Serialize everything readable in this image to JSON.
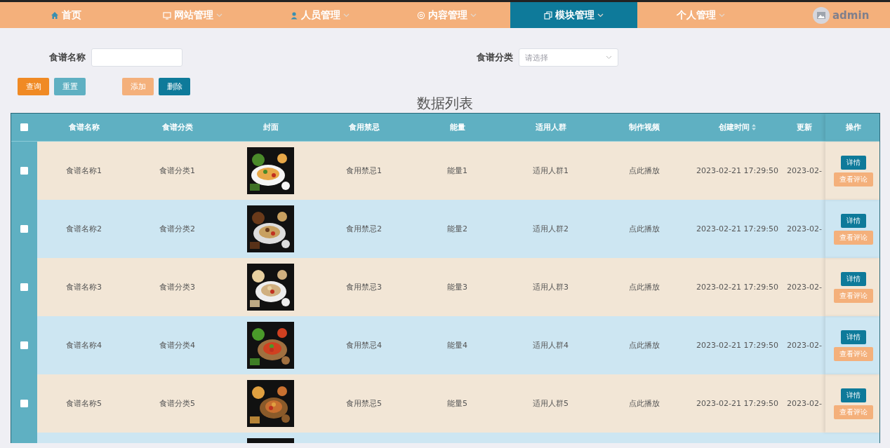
{
  "nav": {
    "items": [
      {
        "label": "首页",
        "dropdown": false,
        "selected": false
      },
      {
        "label": "网站管理",
        "dropdown": true,
        "selected": false
      },
      {
        "label": "人员管理",
        "dropdown": true,
        "selected": false
      },
      {
        "label": "内容管理",
        "dropdown": true,
        "selected": false
      },
      {
        "label": "模块管理",
        "dropdown": true,
        "selected": true
      },
      {
        "label": "个人管理",
        "dropdown": true,
        "selected": false
      }
    ],
    "user": "admin"
  },
  "filters": [
    {
      "label": "食谱名称",
      "kind": "text"
    },
    {
      "label": "食谱分类",
      "kind": "select",
      "placeholder": "请选择"
    }
  ],
  "buttons": [
    {
      "label": "查询",
      "kind": "query"
    },
    {
      "label": "重置",
      "kind": "reset"
    },
    {
      "label": "添加",
      "kind": "add"
    },
    {
      "label": "删除",
      "kind": "delete"
    }
  ],
  "list_title": "数据列表",
  "table": {
    "select_all": {
      "checked": false
    },
    "columns": [
      {
        "label": "食谱名称",
        "sortable": false
      },
      {
        "label": "食谱分类",
        "sortable": false
      },
      {
        "label": "封面",
        "sortable": false
      },
      {
        "label": "食用禁忌",
        "sortable": false
      },
      {
        "label": "能量",
        "sortable": false
      },
      {
        "label": "适用人群",
        "sortable": false
      },
      {
        "label": "制作视频",
        "sortable": false
      },
      {
        "label": "创建时间",
        "sortable": true
      },
      {
        "label": "更新",
        "sortable": false
      },
      {
        "label": "操作",
        "sortable": false
      }
    ],
    "rows": [
      {
        "checked": false,
        "name": "食谱名称1",
        "category": "食谱分类1",
        "taboo": "食用禁忌1",
        "energy": "能量1",
        "crowd": "适用人群1",
        "video": "点此播放",
        "created": "2023-02-21 17:29:50",
        "updated": "2023-02-",
        "actions": [
          "详情",
          "查看评论"
        ]
      },
      {
        "checked": false,
        "name": "食谱名称2",
        "category": "食谱分类2",
        "taboo": "食用禁忌2",
        "energy": "能量2",
        "crowd": "适用人群2",
        "video": "点此播放",
        "created": "2023-02-21 17:29:50",
        "updated": "2023-02-",
        "actions": [
          "详情",
          "查看评论"
        ]
      },
      {
        "checked": false,
        "name": "食谱名称3",
        "category": "食谱分类3",
        "taboo": "食用禁忌3",
        "energy": "能量3",
        "crowd": "适用人群3",
        "video": "点此播放",
        "created": "2023-02-21 17:29:50",
        "updated": "2023-02-",
        "actions": [
          "详情",
          "查看评论"
        ]
      },
      {
        "checked": false,
        "name": "食谱名称4",
        "category": "食谱分类4",
        "taboo": "食用禁忌4",
        "energy": "能量4",
        "crowd": "适用人群4",
        "video": "点此播放",
        "created": "2023-02-21 17:29:50",
        "updated": "2023-02-",
        "actions": [
          "详情",
          "查看评论"
        ]
      },
      {
        "checked": false,
        "name": "食谱名称5",
        "category": "食谱分类5",
        "taboo": "食用禁忌5",
        "energy": "能量5",
        "crowd": "适用人群5",
        "video": "点此播放",
        "created": "2023-02-21 17:29:50",
        "updated": "2023-02-",
        "actions": [
          "详情",
          "查看评论"
        ]
      }
    ]
  }
}
